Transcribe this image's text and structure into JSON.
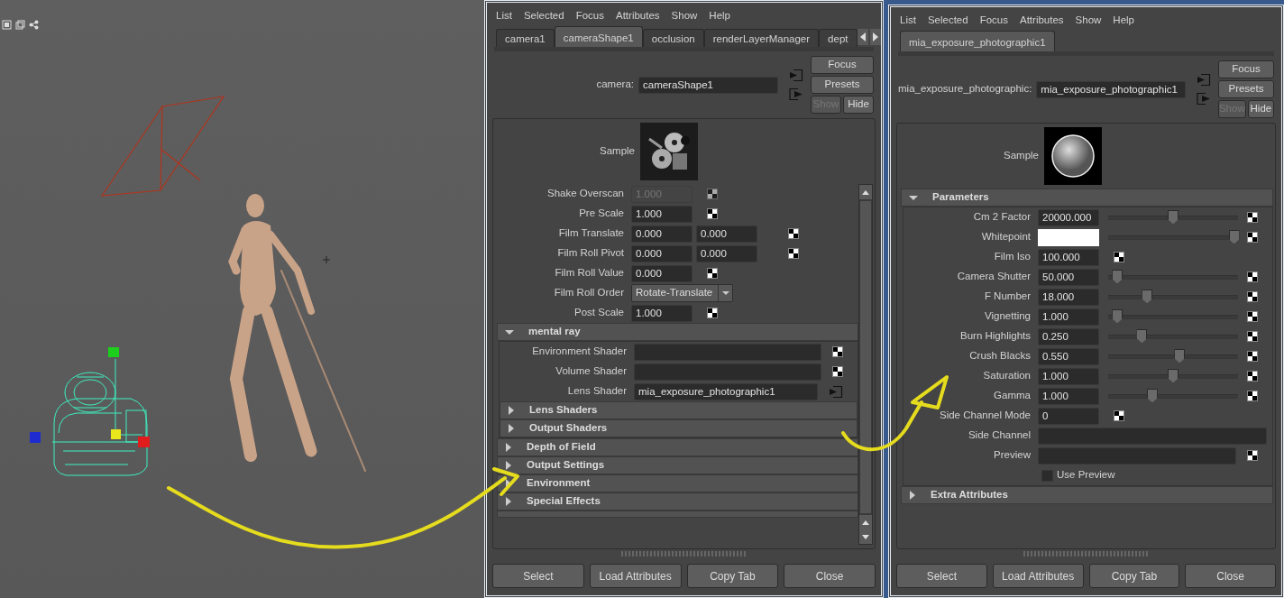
{
  "editors": [
    {
      "menu": [
        "List",
        "Selected",
        "Focus",
        "Attributes",
        "Show",
        "Help"
      ],
      "tabs": [
        {
          "label": "camera1",
          "selected": false
        },
        {
          "label": "cameraShape1",
          "selected": true
        },
        {
          "label": "occlusion",
          "selected": false
        },
        {
          "label": "renderLayerManager",
          "selected": false
        },
        {
          "label": "dept",
          "selected": false
        }
      ],
      "tab_scroll": true,
      "node_label": "camera:",
      "node_name": "cameraShape1",
      "buttons": [
        {
          "label": "Focus",
          "disabled": false
        },
        {
          "label": "Presets",
          "disabled": false
        },
        {
          "label": "Show",
          "disabled": true
        },
        {
          "label": "Hide",
          "disabled": false
        }
      ],
      "sample": {
        "label": "Sample",
        "kind": "camera"
      },
      "scrolled": true,
      "attributes": [
        {
          "kind": "field",
          "label": "Shake Overscan",
          "values": [
            "1.000"
          ],
          "disabled": true,
          "map": {
            "kind": "checker"
          }
        },
        {
          "kind": "field",
          "label": "Pre Scale",
          "values": [
            "1.000"
          ],
          "disabled": false,
          "map": {
            "kind": "checker"
          }
        },
        {
          "kind": "field",
          "label": "Film Translate",
          "values": [
            "0.000",
            "0.000"
          ],
          "disabled": false,
          "map": {
            "kind": "checker"
          }
        },
        {
          "kind": "field",
          "label": "Film Roll Pivot",
          "values": [
            "0.000",
            "0.000"
          ],
          "disabled": false,
          "map": {
            "kind": "checker"
          }
        },
        {
          "kind": "field",
          "label": "Film Roll Value",
          "values": [
            "0.000"
          ],
          "disabled": false,
          "map": {
            "kind": "checker"
          }
        },
        {
          "kind": "dropdown",
          "label": "Film Roll Order",
          "value": "Rotate-Translate"
        },
        {
          "kind": "field",
          "label": "Post Scale",
          "values": [
            "1.000"
          ],
          "disabled": false,
          "map": {
            "kind": "checker"
          }
        },
        {
          "kind": "section",
          "label": "mental ray",
          "expanded": true,
          "children": [
            {
              "kind": "shader",
              "label": "Environment Shader",
              "map": {
                "kind": "checker"
              }
            },
            {
              "kind": "shader",
              "label": "Volume Shader",
              "map": {
                "kind": "checker"
              }
            },
            {
              "kind": "shader",
              "label": "Lens Shader",
              "value": "mia_exposure_photographic1",
              "map": {
                "kind": "connected"
              }
            },
            {
              "kind": "section",
              "label": "Lens Shaders",
              "expanded": false
            },
            {
              "kind": "section",
              "label": "Output Shaders",
              "expanded": false
            }
          ]
        },
        {
          "kind": "section",
          "label": "Depth of Field",
          "expanded": false
        },
        {
          "kind": "section",
          "label": "Output Settings",
          "expanded": false
        },
        {
          "kind": "section",
          "label": "Environment",
          "expanded": false
        },
        {
          "kind": "section",
          "label": "Special Effects",
          "expanded": false
        }
      ],
      "footer": [
        "Select",
        "Load Attributes",
        "Copy Tab",
        "Close"
      ]
    },
    {
      "menu": [
        "List",
        "Selected",
        "Focus",
        "Attributes",
        "Show",
        "Help"
      ],
      "tabs": [
        {
          "label": "mia_exposure_photographic1",
          "selected": true
        }
      ],
      "tab_scroll": false,
      "node_label": "mia_exposure_photographic:",
      "node_name": "mia_exposure_photographic1",
      "buttons": [
        {
          "label": "Focus",
          "disabled": false
        },
        {
          "label": "Presets",
          "disabled": false
        },
        {
          "label": "Show",
          "disabled": true
        },
        {
          "label": "Hide",
          "disabled": false
        }
      ],
      "sample": {
        "label": "Sample",
        "kind": "sphere"
      },
      "scrolled": false,
      "attributes": [
        {
          "kind": "section",
          "label": "Parameters",
          "expanded": true,
          "children": [
            {
              "kind": "slider",
              "label": "Cm 2 Factor",
              "value": "20000.000",
              "level": 0.5,
              "map": {
                "kind": "checker"
              }
            },
            {
              "kind": "color",
              "label": "Whitepoint",
              "color": "#ffffff",
              "level": 0.97,
              "map": {
                "kind": "checker"
              }
            },
            {
              "kind": "field",
              "label": "Film Iso",
              "values": [
                "100.000"
              ],
              "disabled": false,
              "map": {
                "kind": "checker"
              }
            },
            {
              "kind": "slider",
              "label": "Camera Shutter",
              "value": "50.000",
              "level": 0.07,
              "map": {
                "kind": "checker"
              }
            },
            {
              "kind": "slider",
              "label": "F Number",
              "value": "18.000",
              "level": 0.3,
              "map": {
                "kind": "checker"
              }
            },
            {
              "kind": "slider",
              "label": "Vignetting",
              "value": "1.000",
              "level": 0.07,
              "map": {
                "kind": "checker"
              }
            },
            {
              "kind": "slider",
              "label": "Burn Highlights",
              "value": "0.250",
              "level": 0.26,
              "map": {
                "kind": "checker"
              }
            },
            {
              "kind": "slider",
              "label": "Crush Blacks",
              "value": "0.550",
              "level": 0.55,
              "map": {
                "kind": "checker"
              }
            },
            {
              "kind": "slider",
              "label": "Saturation",
              "value": "1.000",
              "level": 0.5,
              "map": {
                "kind": "checker"
              }
            },
            {
              "kind": "slider",
              "label": "Gamma",
              "value": "1.000",
              "level": 0.34,
              "map": {
                "kind": "checker"
              }
            },
            {
              "kind": "field",
              "label": "Side Channel Mode",
              "values": [
                "0"
              ],
              "disabled": false,
              "map": {
                "kind": "checker"
              }
            },
            {
              "kind": "shader",
              "label": "Side Channel"
            },
            {
              "kind": "shader",
              "label": "Preview",
              "map": {
                "kind": "checker"
              }
            },
            {
              "kind": "checkbox",
              "label": "Use Preview",
              "checked": false
            }
          ]
        },
        {
          "kind": "section",
          "label": "Extra Attributes",
          "expanded": false
        }
      ],
      "footer": [
        "Select",
        "Load Attributes",
        "Copy Tab",
        "Close"
      ]
    }
  ]
}
